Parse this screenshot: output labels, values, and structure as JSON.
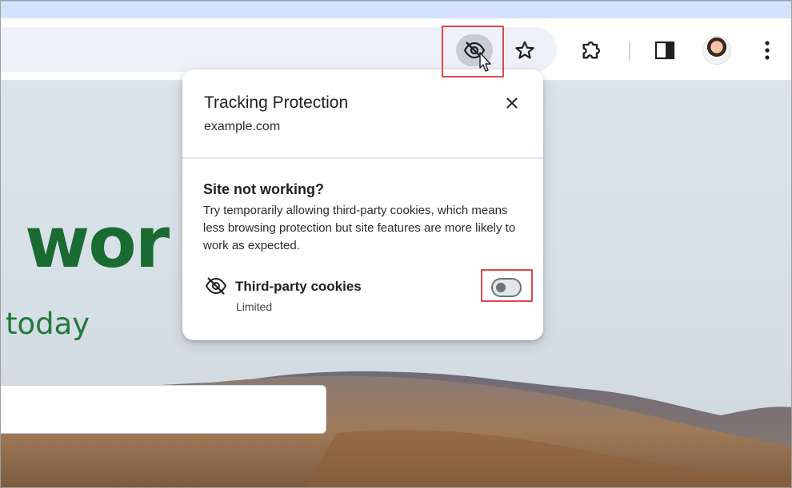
{
  "toolbar": {
    "icons": [
      "tracking-protection-icon",
      "star-icon",
      "extensions-icon",
      "side-panel-icon",
      "avatar",
      "more-vert-icon"
    ]
  },
  "page": {
    "hero_word": "wor",
    "hero_sub": "today"
  },
  "popup": {
    "title": "Tracking Protection",
    "domain": "example.com",
    "section_title": "Site not working?",
    "section_body": "Try temporarily allowing third-party cookies, which means less browsing protection but site features are more likely to work as expected.",
    "cookies": {
      "label": "Third-party cookies",
      "status": "Limited",
      "toggle_on": false
    }
  },
  "colors": {
    "highlight": "#e0454b",
    "hero_green": "#1a6b32",
    "toolbar_active_bg": "#c8ccd3"
  }
}
